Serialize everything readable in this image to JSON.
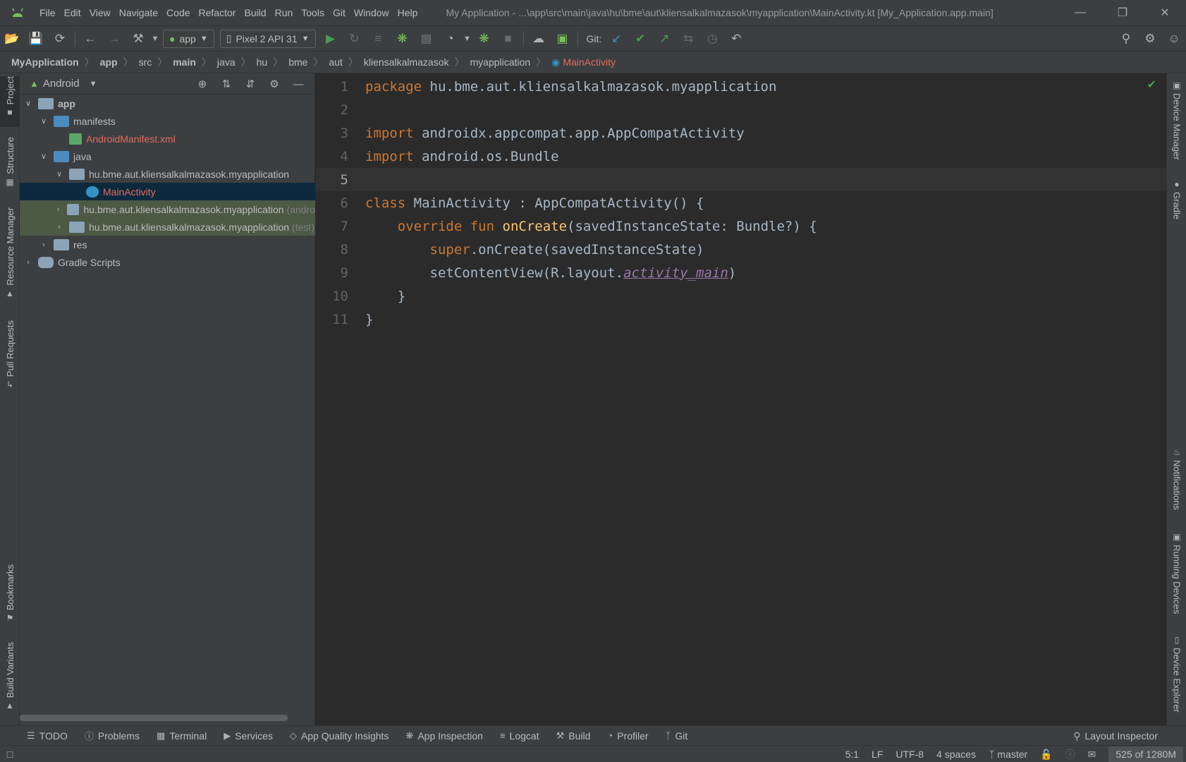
{
  "window": {
    "title": "My Application - ...\\app\\src\\main\\java\\hu\\bme\\aut\\kliensalkalmazasok\\myapplication\\MainActivity.kt [My_Application.app.main]"
  },
  "menu": {
    "items": [
      "File",
      "Edit",
      "View",
      "Navigate",
      "Code",
      "Refactor",
      "Build",
      "Run",
      "Tools",
      "Git",
      "Window",
      "Help"
    ]
  },
  "toolbar": {
    "run_config": "app",
    "device": "Pixel 2 API 31",
    "git_label": "Git:"
  },
  "breadcrumb": {
    "items": [
      "MyApplication",
      "app",
      "src",
      "main",
      "java",
      "hu",
      "bme",
      "aut",
      "kliensalkalmazasok",
      "myapplication",
      "MainActivity"
    ]
  },
  "left_tabs": {
    "project": "Project",
    "structure": "Structure",
    "resource_manager": "Resource Manager",
    "pull_requests": "Pull Requests",
    "bookmarks": "Bookmarks",
    "build_variants": "Build Variants"
  },
  "right_tabs": {
    "device_manager": "Device Manager",
    "gradle": "Gradle",
    "notifications": "Notifications",
    "running_devices": "Running Devices",
    "device_explorer": "Device Explorer"
  },
  "project_panel": {
    "view_mode": "Android",
    "tree": {
      "app": "app",
      "manifests": "manifests",
      "manifest_file": "AndroidManifest.xml",
      "java": "java",
      "pkg_main": "hu.bme.aut.kliensalkalmazasok.myapplication",
      "main_activity": "MainActivity",
      "pkg_android_test": "hu.bme.aut.kliensalkalmazasok.myapplication",
      "pkg_android_test_suffix": "(andro",
      "pkg_test": "hu.bme.aut.kliensalkalmazasok.myapplication",
      "pkg_test_suffix": "(test)",
      "res": "res",
      "gradle_scripts": "Gradle Scripts"
    }
  },
  "editor": {
    "current_line": 5,
    "lines": {
      "l1_kw": "package",
      "l1_rest": " hu.bme.aut.kliensalkalmazasok.myapplication",
      "l3_kw": "import",
      "l3_rest": " androidx.appcompat.app.AppCompatActivity",
      "l4_kw": "import",
      "l4_rest": " android.os.Bundle",
      "l6_kw": "class",
      "l6_rest": " MainActivity : AppCompatActivity() {",
      "l7_indent": "    ",
      "l7_kw1": "override",
      "l7_sp": " ",
      "l7_kw2": "fun",
      "l7_sp2": " ",
      "l7_fn": "onCreate",
      "l7_rest": "(savedInstanceState: Bundle?) {",
      "l8_indent": "        ",
      "l8_kw": "super",
      "l8_rest": ".onCreate(savedInstanceState)",
      "l9_indent": "        ",
      "l9_pre": "setContentView(R.layout.",
      "l9_link": "activity_main",
      "l9_post": ")",
      "l10": "    }",
      "l11": "}"
    }
  },
  "bottom_tabs": [
    "TODO",
    "Problems",
    "Terminal",
    "Services",
    "App Quality Insights",
    "App Inspection",
    "Logcat",
    "Build",
    "Profiler",
    "Git"
  ],
  "bottom_right_tab": "Layout Inspector",
  "status": {
    "position": "5:1",
    "line_sep": "LF",
    "encoding": "UTF-8",
    "indent": "4 spaces",
    "branch": "master",
    "memory": "525 of 1280M"
  }
}
